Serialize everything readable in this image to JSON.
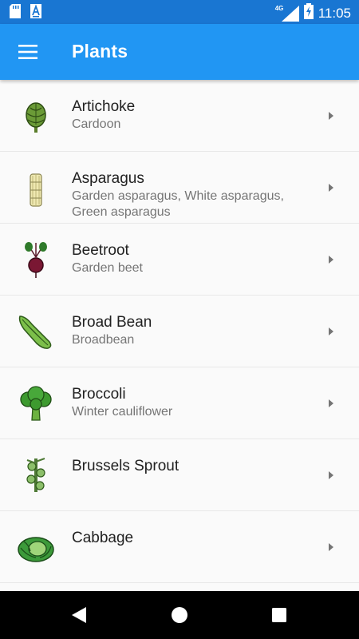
{
  "status_bar": {
    "time": "11:05",
    "network": "4G",
    "icons": [
      "sd-card-icon",
      "a-notification-icon",
      "signal-icon",
      "battery-charging-icon"
    ]
  },
  "app_bar": {
    "title": "Plants",
    "menu_icon": "hamburger-menu-icon"
  },
  "plants": [
    {
      "name": "Artichoke",
      "subtitle": "Cardoon",
      "icon": "artichoke-icon"
    },
    {
      "name": "Asparagus",
      "subtitle": "Garden asparagus, White asparagus, Green asparagus",
      "icon": "asparagus-icon"
    },
    {
      "name": "Beetroot",
      "subtitle": "Garden beet",
      "icon": "beetroot-icon"
    },
    {
      "name": "Broad Bean",
      "subtitle": "Broadbean",
      "icon": "broad-bean-icon"
    },
    {
      "name": "Broccoli",
      "subtitle": "Winter cauliflower",
      "icon": "broccoli-icon"
    },
    {
      "name": "Brussels Sprout",
      "subtitle": "",
      "icon": "brussels-sprout-icon"
    },
    {
      "name": "Cabbage",
      "subtitle": "",
      "icon": "cabbage-icon"
    }
  ],
  "nav_bar": {
    "buttons": [
      "back-icon",
      "home-icon",
      "recents-icon"
    ]
  },
  "colors": {
    "status_bar": "#1976d2",
    "app_bar": "#2196f3",
    "background": "#fafafa"
  }
}
